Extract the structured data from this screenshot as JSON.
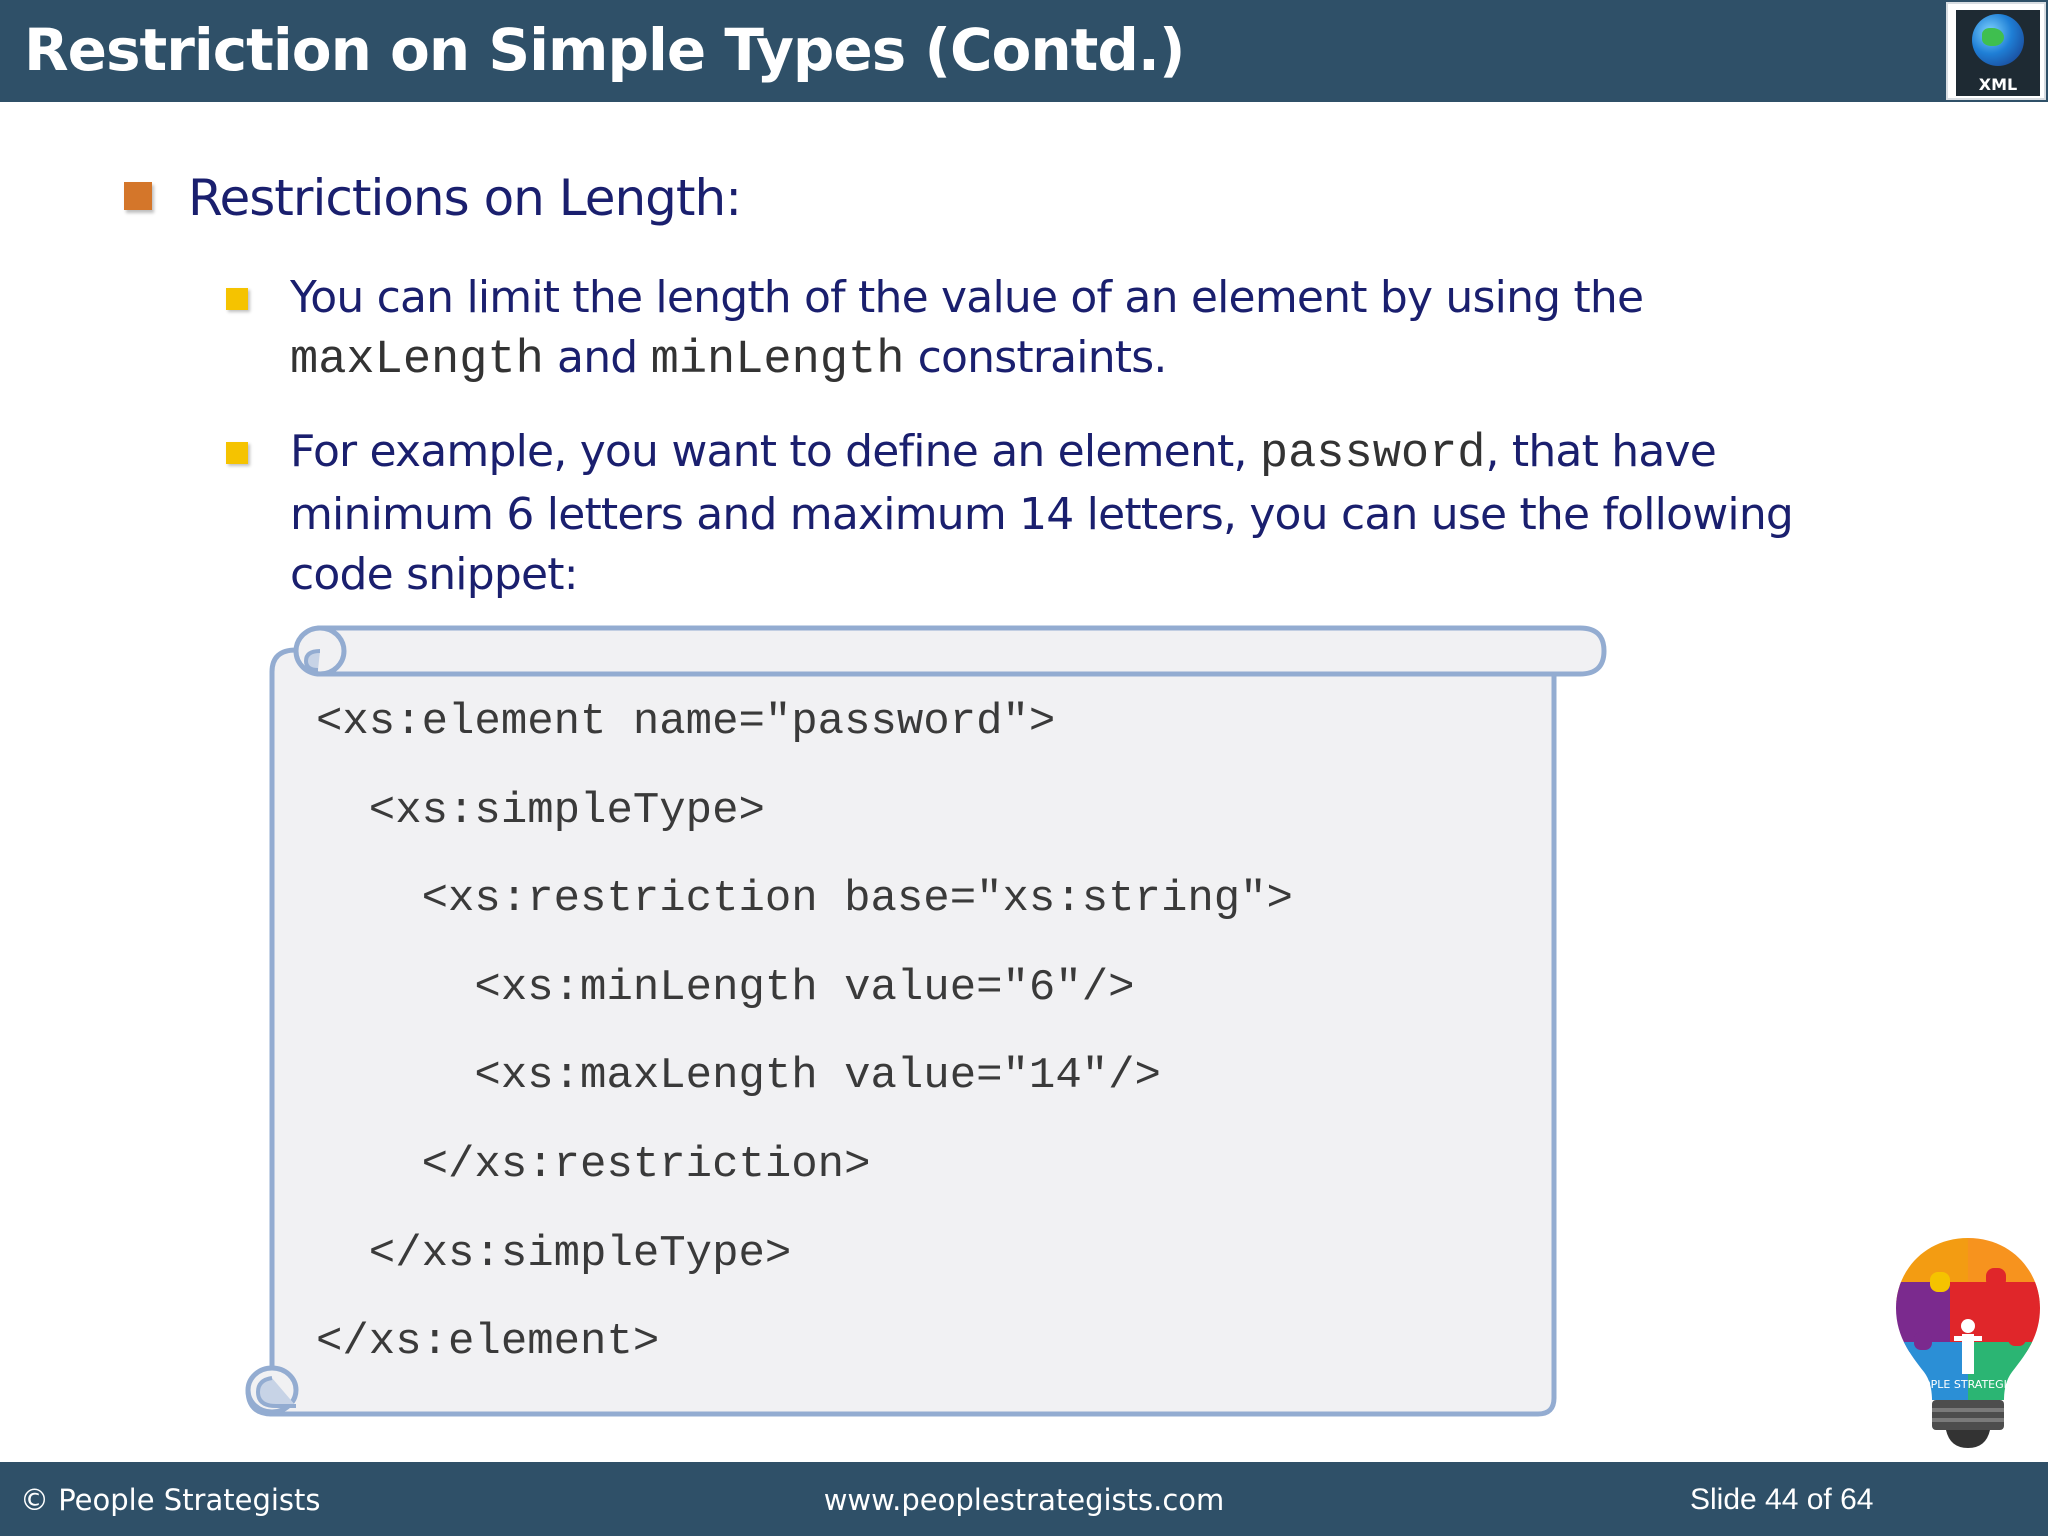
{
  "header": {
    "title": "Restriction on Simple Types (Contd.)",
    "logo_label": "XML"
  },
  "content": {
    "heading": "Restrictions on Length:",
    "points": [
      {
        "line1": "You can limit the length of the value of an element by using the",
        "code_a": "maxLength",
        "and": " and ",
        "code_b": "minLength",
        "tail": " constraints."
      },
      {
        "pre": "For example, you want to define an element, ",
        "code": "password",
        "post": ", that have minimum 6 letters and maximum 14 letters, you can use the following code snippet:"
      }
    ]
  },
  "code_snippet": {
    "lines": [
      "<xs:element name=\"password\">",
      "  <xs:simpleType>",
      "    <xs:restriction base=\"xs:string\">",
      "      <xs:minLength value=\"6\"/>",
      "      <xs:maxLength value=\"14\"/>",
      "    </xs:restriction>",
      "  </xs:simpleType>",
      "</xs:element>"
    ]
  },
  "brand_logo": {
    "text": "PEOPLE STRATEGISTS"
  },
  "footer": {
    "copyright": "© People Strategists",
    "website": "www.peoplestrategists.com",
    "slide_info": "Slide 44 of 64"
  },
  "colors": {
    "header_bg": "#2f5068",
    "heading_text": "#1a1f6e",
    "bullet_primary": "#d4762a",
    "bullet_secondary": "#f5c300",
    "scroll_border": "#93acd1",
    "scroll_fill": "#f1f1f3"
  },
  "icons": [
    "xml-globe-icon",
    "lightbulb-puzzle-icon"
  ]
}
